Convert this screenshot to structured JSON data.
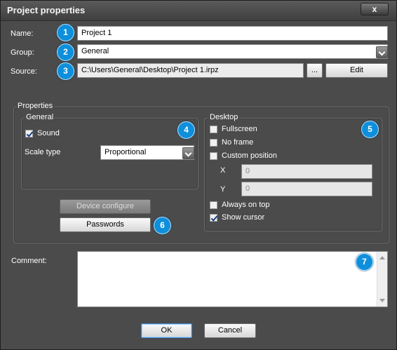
{
  "window": {
    "title": "Project properties",
    "close_label": "x"
  },
  "fields": {
    "name_label": "Name:",
    "name_value": "Project 1",
    "group_label": "Group:",
    "group_value": "General",
    "source_label": "Source:",
    "source_value": "C:\\Users\\General\\Desktop\\Project 1.irpz",
    "browse_label": "...",
    "edit_label": "Edit"
  },
  "properties": {
    "title": "Properties",
    "general": {
      "title": "General",
      "sound_label": "Sound",
      "sound_checked": true,
      "scale_type_label": "Scale type",
      "scale_type_value": "Proportional"
    },
    "desktop": {
      "title": "Desktop",
      "fullscreen_label": "Fullscreen",
      "no_frame_label": "No frame",
      "custom_position_label": "Custom position",
      "x_label": "X",
      "x_value": "0",
      "y_label": "Y",
      "y_value": "0",
      "always_on_top_label": "Always on top",
      "show_cursor_label": "Show cursor",
      "show_cursor_checked": true
    },
    "device_configure_label": "Device configure",
    "passwords_label": "Passwords"
  },
  "comment": {
    "label": "Comment:",
    "value": ""
  },
  "footer": {
    "ok_label": "OK",
    "cancel_label": "Cancel"
  },
  "badges": [
    "1",
    "2",
    "3",
    "4",
    "5",
    "6",
    "7"
  ],
  "colors": {
    "badge": "#0e8fdc",
    "dialog_bg": "#4b4b4b"
  }
}
